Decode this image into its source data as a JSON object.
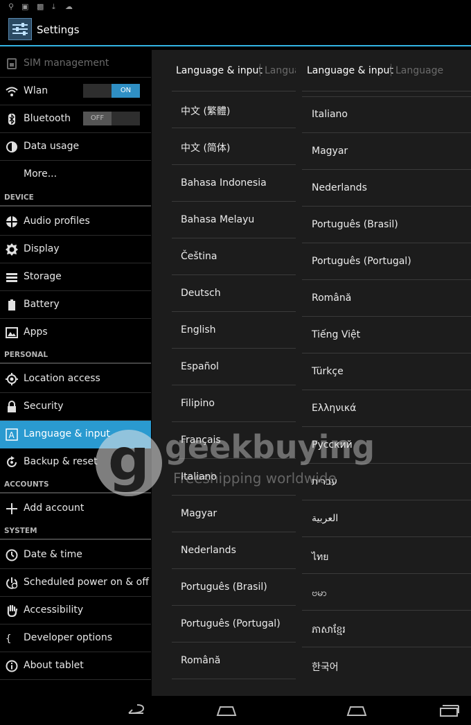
{
  "app": {
    "title": "Settings"
  },
  "sidebar": {
    "items": [
      {
        "label": "SIM management",
        "icon": "sim-icon"
      },
      {
        "label": "Wlan",
        "icon": "wifi-icon",
        "toggle": "ON"
      },
      {
        "label": "Bluetooth",
        "icon": "bluetooth-icon",
        "toggle": "OFF"
      },
      {
        "label": "Data usage",
        "icon": "data-usage-icon"
      },
      {
        "label": "More..."
      }
    ],
    "device_header": "DEVICE",
    "device_items": [
      {
        "label": "Audio profiles",
        "icon": "audio-icon"
      },
      {
        "label": "Display",
        "icon": "display-icon"
      },
      {
        "label": "Storage",
        "icon": "storage-icon"
      },
      {
        "label": "Battery",
        "icon": "battery-icon"
      },
      {
        "label": "Apps",
        "icon": "apps-icon"
      }
    ],
    "personal_header": "PERSONAL",
    "personal_items": [
      {
        "label": "Location access",
        "icon": "location-icon"
      },
      {
        "label": "Security",
        "icon": "lock-icon"
      },
      {
        "label": "Language & input",
        "icon": "keyboard-icon",
        "selected": true
      },
      {
        "label": "Backup & reset",
        "icon": "backup-icon"
      }
    ],
    "accounts_header": "ACCOUNTS",
    "accounts_items": [
      {
        "label": "Add account",
        "icon": "plus-icon"
      }
    ],
    "system_header": "SYSTEM",
    "system_items": [
      {
        "label": "Date & time",
        "icon": "clock-icon"
      },
      {
        "label": "Scheduled power on & off",
        "icon": "power-schedule-icon"
      },
      {
        "label": "Accessibility",
        "icon": "hand-icon"
      },
      {
        "label": "Developer options",
        "icon": "braces-icon"
      },
      {
        "label": "About tablet",
        "icon": "info-icon"
      }
    ]
  },
  "panel": {
    "left_breadcrumb": {
      "current": "Language & input",
      "next": "Langua"
    },
    "right_breadcrumb": {
      "current": "Language & input",
      "next": "Language"
    },
    "left_list": [
      "中文 (繁體)",
      "中文 (简体)",
      "Bahasa Indonesia",
      "Bahasa Melayu",
      "Čeština",
      "Deutsch",
      "English",
      "Español",
      "Filipino",
      "Français",
      "Italiano",
      "Magyar",
      "Nederlands",
      "Português (Brasil)",
      "Português (Portugal)",
      "Română"
    ],
    "right_list": [
      "Italiano",
      "Magyar",
      "Nederlands",
      "Português (Brasil)",
      "Português (Portugal)",
      "Română",
      "Tiếng Việt",
      "Türkçe",
      "Ελληνικά",
      "Русский",
      "עברית",
      "العربية",
      "ไทย",
      "ဗမာ",
      "ភាសាខ្មែរ",
      "한국어"
    ]
  },
  "watermark": {
    "brand": "geekbuying",
    "tagline": "Freeshipping worldwide"
  },
  "navbar": {
    "buttons": [
      "back-icon",
      "home-icon",
      "home-icon",
      "recent-apps-icon"
    ]
  },
  "colors": {
    "accent": "#33b5e5",
    "selected": "#2a9ad0"
  }
}
